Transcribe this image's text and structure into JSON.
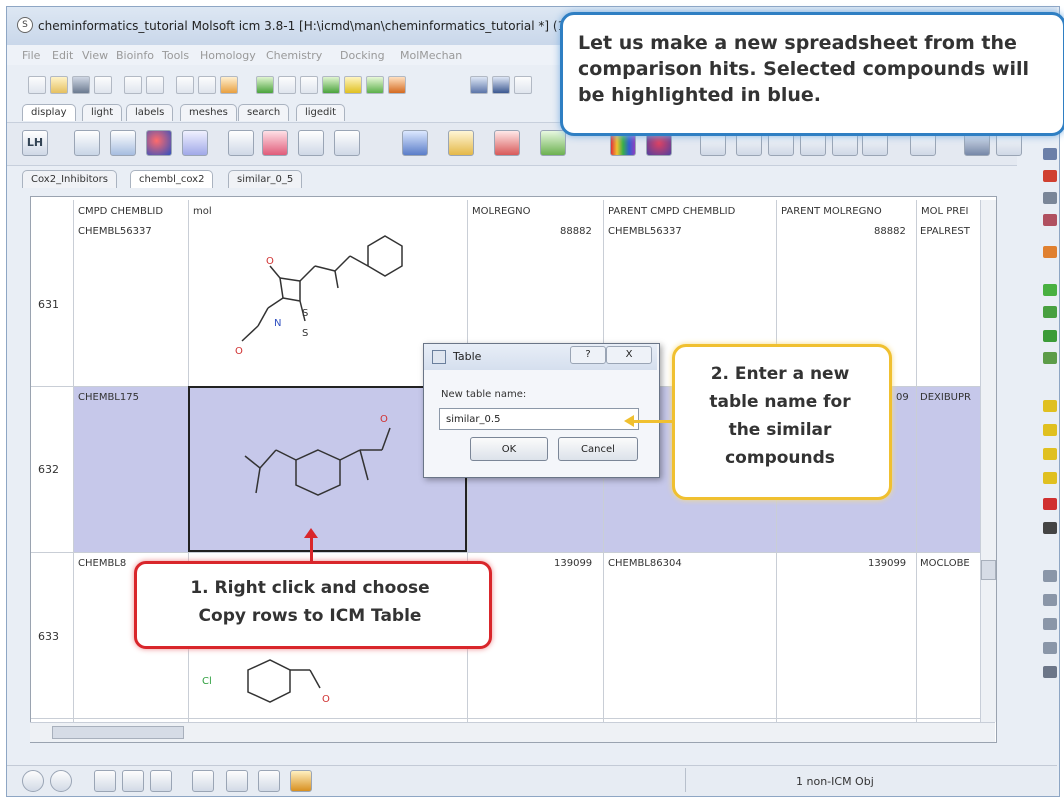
{
  "window": {
    "title": "cheminformatics_tutorial Molsoft icm 3.8-1  [H:\\icmd\\man\\cheminformatics_tutorial *] (1"
  },
  "menu": [
    "File",
    "Edit",
    "View",
    "Bioinfo",
    "Tools",
    "Homology",
    "Chemistry",
    "Docking",
    "MolMechan"
  ],
  "panel_tabs": [
    "display",
    "light",
    "labels",
    "meshes",
    "search",
    "ligedit"
  ],
  "sheet_tabs": [
    "Cox2_Inhibitors",
    "chembl_cox2",
    "similar_0_5"
  ],
  "active_sheet_tab": 1,
  "table": {
    "columns": [
      "CMPD CHEMBLID",
      "mol",
      "MOLREGNO",
      "PARENT CMPD CHEMBLID",
      "PARENT MOLREGNO",
      "MOL PREI"
    ],
    "rows": [
      {
        "num": "631",
        "chembl": "CHEMBL56337",
        "molregno": "88882",
        "parent": "CHEMBL56337",
        "parent_molregno": "88882",
        "pref": "EPALREST",
        "selected": false
      },
      {
        "num": "632",
        "chembl": "CHEMBL175",
        "molregno": "",
        "parent": "",
        "parent_molregno": "09",
        "pref": "DEXIBUPR",
        "selected": true
      },
      {
        "num": "633",
        "chembl": "CHEMBL8",
        "molregno": "139099",
        "parent": "CHEMBL86304",
        "parent_molregno": "139099",
        "pref": "MOCLOBE",
        "selected": false
      }
    ]
  },
  "dialog": {
    "title": "Table",
    "help": "?",
    "close": "X",
    "label": "New table name:",
    "value": "similar_0.5",
    "ok": "OK",
    "cancel": "Cancel"
  },
  "callouts": {
    "top": "Let us make a new spreadsheet from the comparison hits. Selected compounds will be highlighted in blue.",
    "red_line1": "1. Right click and choose",
    "red_line2": "Copy rows to ICM Table",
    "yellow_line1": "2. Enter a new",
    "yellow_line2": "table name for",
    "yellow_line3": "the similar",
    "yellow_line4": "compounds"
  },
  "labels": {
    "lh": "LH",
    "atom_o": "O",
    "atom_s": "S",
    "atom_n": "N",
    "atom_cl": "Cl"
  },
  "status": {
    "text": "1 non-ICM Obj"
  },
  "colors": {
    "selection": "#c6c8ea",
    "callout_blue": "#2f7fc3",
    "callout_red": "#d9262b",
    "callout_yellow": "#f0c030"
  }
}
